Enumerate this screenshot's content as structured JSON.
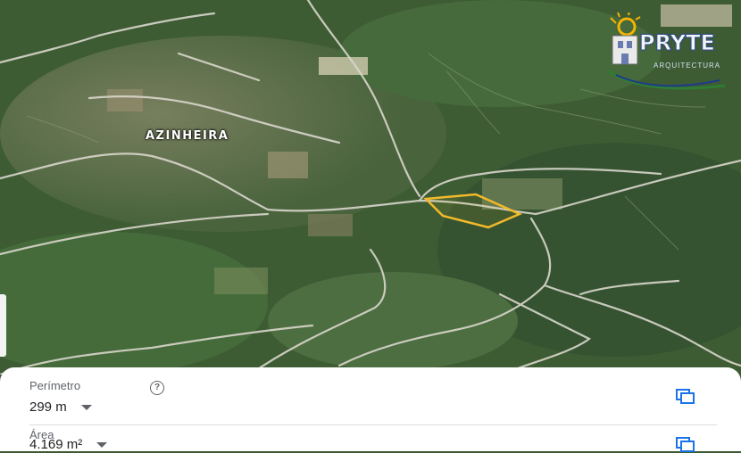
{
  "map": {
    "place_label": "AZINHEIRA",
    "logo": {
      "text": "PRYTE",
      "subtext": "ARQUITECTURA"
    },
    "parcel_outline_color": "#f2b92a"
  },
  "measure": {
    "perimeter_label": "Perímetro",
    "perimeter_value": "299 m",
    "area_label": "Área",
    "area_value": "4.169 m²",
    "help_glyph": "?",
    "copy_icon": "copy-icon"
  },
  "colors": {
    "accent": "#1a73e8",
    "vegetation": "#3c5a32",
    "road": "#d9d6cc"
  }
}
